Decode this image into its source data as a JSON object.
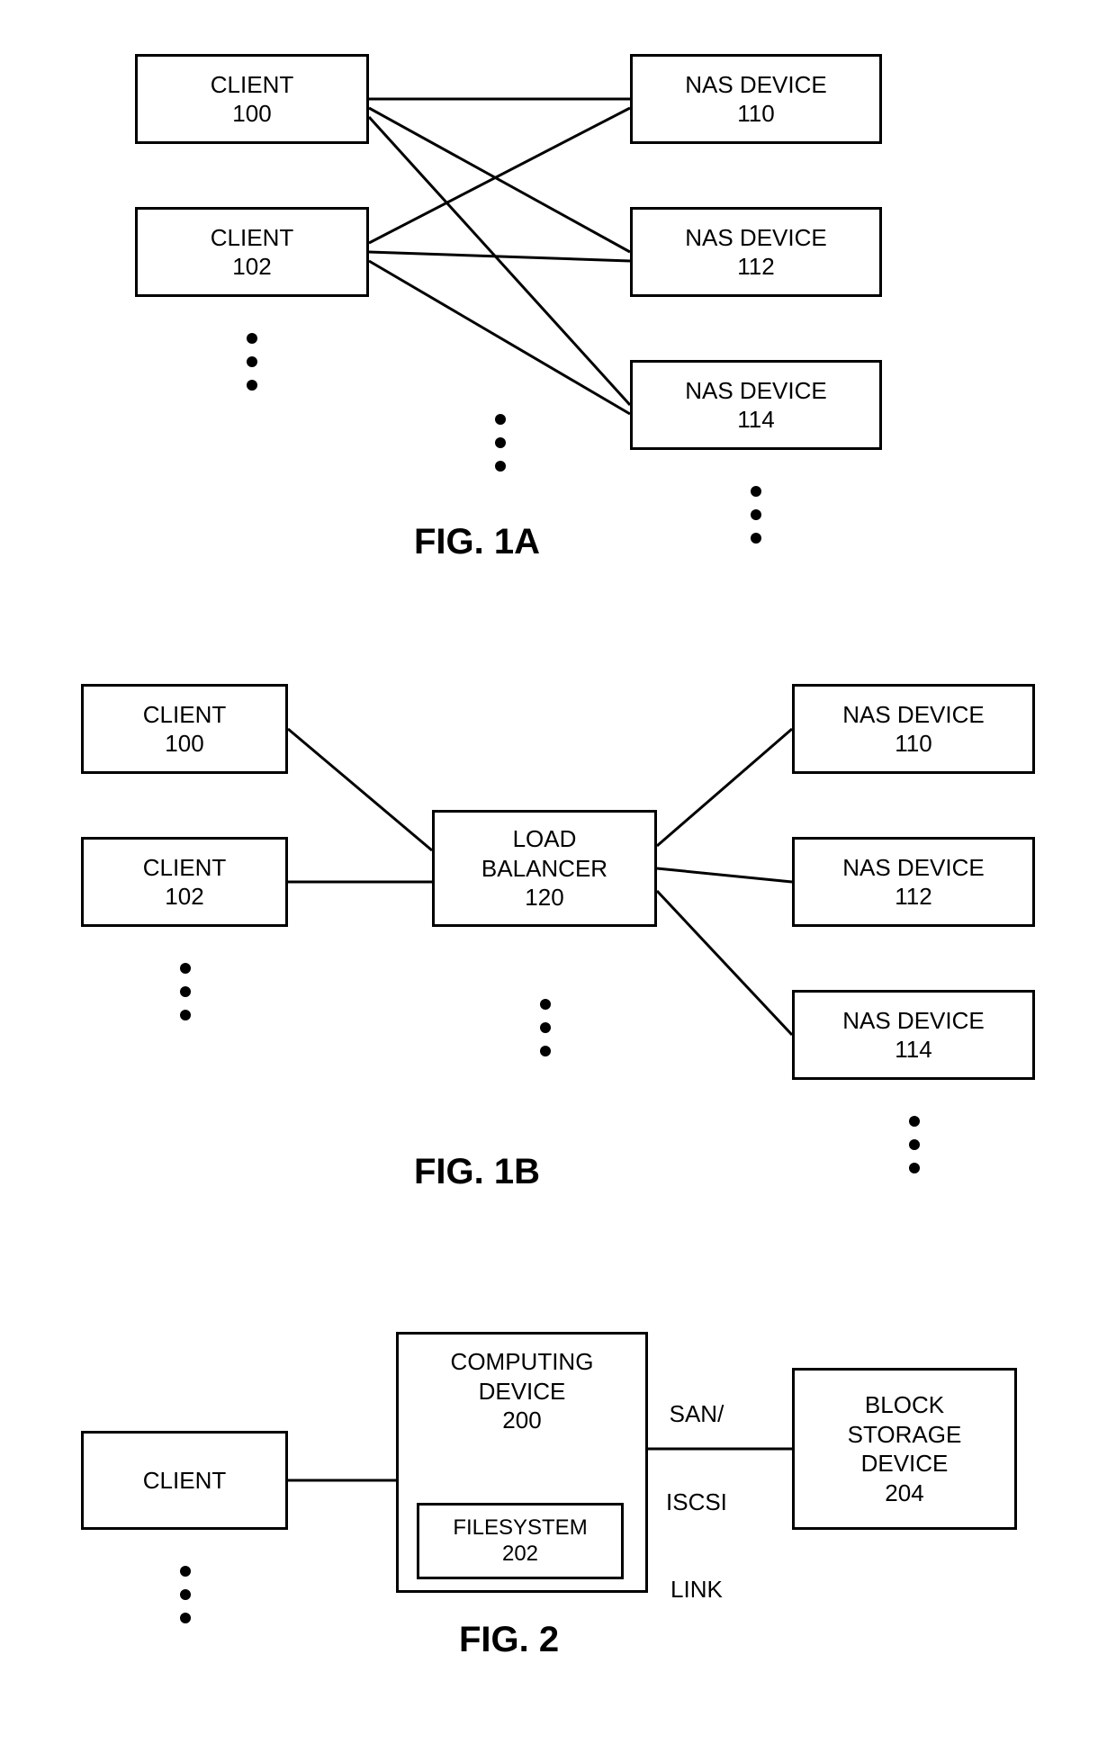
{
  "fig1a": {
    "label": "FIG. 1A",
    "client100": {
      "l1": "CLIENT",
      "l2": "100"
    },
    "client102": {
      "l1": "CLIENT",
      "l2": "102"
    },
    "nas110": {
      "l1": "NAS DEVICE",
      "l2": "110"
    },
    "nas112": {
      "l1": "NAS DEVICE",
      "l2": "112"
    },
    "nas114": {
      "l1": "NAS DEVICE",
      "l2": "114"
    }
  },
  "fig1b": {
    "label": "FIG. 1B",
    "client100": {
      "l1": "CLIENT",
      "l2": "100"
    },
    "client102": {
      "l1": "CLIENT",
      "l2": "102"
    },
    "lb": {
      "l1": "LOAD",
      "l2": "BALANCER",
      "l3": "120"
    },
    "nas110": {
      "l1": "NAS DEVICE",
      "l2": "110"
    },
    "nas112": {
      "l1": "NAS DEVICE",
      "l2": "112"
    },
    "nas114": {
      "l1": "NAS DEVICE",
      "l2": "114"
    }
  },
  "fig2": {
    "label": "FIG. 2",
    "client": {
      "l1": "CLIENT"
    },
    "compute": {
      "l1": "COMPUTING",
      "l2": "DEVICE",
      "l3": "200"
    },
    "fs": {
      "l1": "FILESYSTEM",
      "l2": "202"
    },
    "link": {
      "l1": "SAN/",
      "l2": "ISCSI",
      "l3": "LINK"
    },
    "block": {
      "l1": "BLOCK",
      "l2": "STORAGE",
      "l3": "DEVICE",
      "l4": "204"
    }
  },
  "chart_data": [
    {
      "type": "diagram",
      "id": "FIG. 1A",
      "title": "Clients directly connected to multiple NAS devices (full mesh)",
      "nodes": [
        {
          "id": "client100",
          "label": "CLIENT 100"
        },
        {
          "id": "client102",
          "label": "CLIENT 102"
        },
        {
          "id": "nas110",
          "label": "NAS DEVICE 110"
        },
        {
          "id": "nas112",
          "label": "NAS DEVICE 112"
        },
        {
          "id": "nas114",
          "label": "NAS DEVICE 114"
        }
      ],
      "edges": [
        [
          "client100",
          "nas110"
        ],
        [
          "client100",
          "nas112"
        ],
        [
          "client100",
          "nas114"
        ],
        [
          "client102",
          "nas110"
        ],
        [
          "client102",
          "nas112"
        ],
        [
          "client102",
          "nas114"
        ]
      ],
      "ellipsis": [
        "more clients",
        "more NAS devices"
      ]
    },
    {
      "type": "diagram",
      "id": "FIG. 1B",
      "title": "Clients via a load balancer to NAS devices",
      "nodes": [
        {
          "id": "client100",
          "label": "CLIENT 100"
        },
        {
          "id": "client102",
          "label": "CLIENT 102"
        },
        {
          "id": "lb120",
          "label": "LOAD BALANCER 120"
        },
        {
          "id": "nas110",
          "label": "NAS DEVICE 110"
        },
        {
          "id": "nas112",
          "label": "NAS DEVICE 112"
        },
        {
          "id": "nas114",
          "label": "NAS DEVICE 114"
        }
      ],
      "edges": [
        [
          "client100",
          "lb120"
        ],
        [
          "client102",
          "lb120"
        ],
        [
          "lb120",
          "nas110"
        ],
        [
          "lb120",
          "nas112"
        ],
        [
          "lb120",
          "nas114"
        ]
      ],
      "ellipsis": [
        "more clients",
        "more NAS devices"
      ]
    },
    {
      "type": "diagram",
      "id": "FIG. 2",
      "title": "Client to computing device with filesystem, linked via SAN/iSCSI to block storage",
      "nodes": [
        {
          "id": "client",
          "label": "CLIENT"
        },
        {
          "id": "cd200",
          "label": "COMPUTING DEVICE 200",
          "contains": [
            "fs202"
          ]
        },
        {
          "id": "fs202",
          "label": "FILESYSTEM 202"
        },
        {
          "id": "bsd204",
          "label": "BLOCK STORAGE DEVICE 204"
        }
      ],
      "edges": [
        [
          "client",
          "cd200"
        ],
        [
          "cd200",
          "bsd204",
          "SAN/ISCSI LINK"
        ]
      ],
      "ellipsis": [
        "more clients"
      ]
    }
  ]
}
